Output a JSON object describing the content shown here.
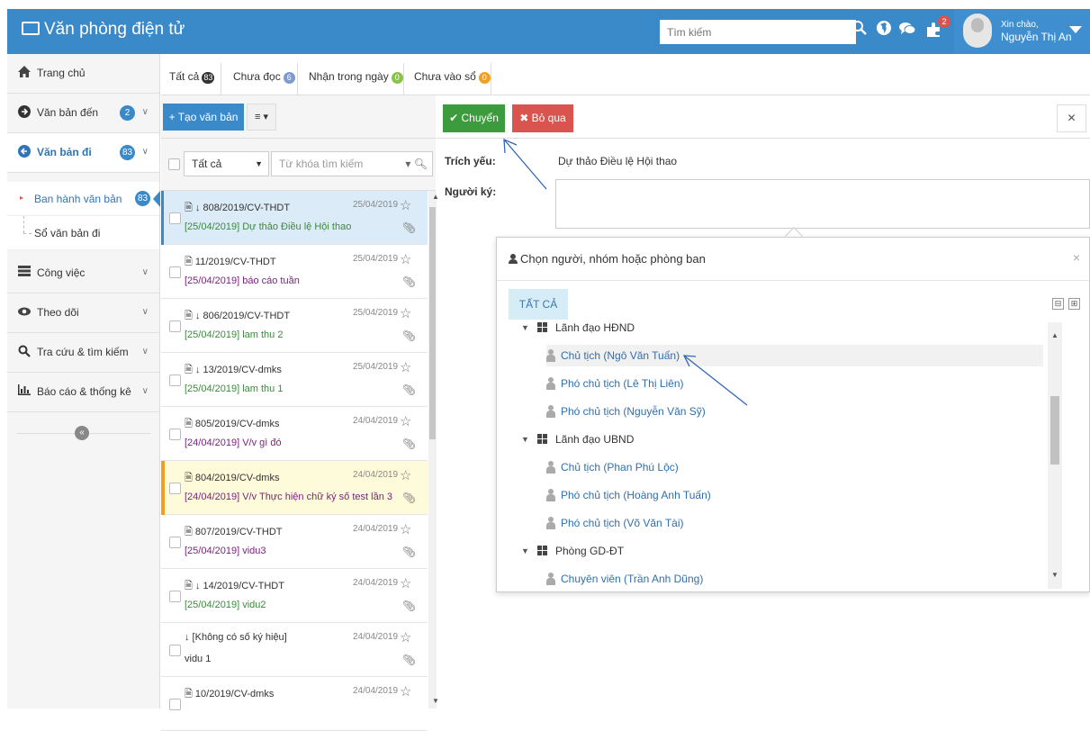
{
  "topbar": {
    "title": "Văn phòng điện tử",
    "search_placeholder": "Tìm kiếm",
    "notify_count": "2",
    "greeting": "Xin chào,",
    "user_name": "Nguyễn Thị An",
    "color": "#3a89c9"
  },
  "sidebar": {
    "home": "Trang chủ",
    "incoming": "Văn bản đến",
    "incoming_count": "2",
    "outgoing": "Văn bản đi",
    "outgoing_count": "83",
    "issue": "Ban hành văn bản",
    "issue_count": "83",
    "register": "Sổ văn bản đi",
    "work": "Công việc",
    "follow": "Theo dõi",
    "search": "Tra cứu & tìm kiếm",
    "reports": "Báo cáo & thống kê"
  },
  "tabs": [
    {
      "label": "Tất cả",
      "count": "83",
      "color": "#333333"
    },
    {
      "label": "Chưa đọc",
      "count": "6",
      "color": "#7e9bd0"
    },
    {
      "label": "Nhận trong ngày",
      "count": "0",
      "color": "#8bc34a"
    },
    {
      "label": "Chưa vào sổ",
      "count": "0",
      "color": "#f0a020"
    }
  ],
  "toolbar": {
    "create": "+ Tạo văn bản",
    "menu": "≡ ▾",
    "send": "✔ Chuyển",
    "skip": "✖ Bỏ qua"
  },
  "filter": {
    "select_value": "Tất cả",
    "keyword_placeholder": "Từ khóa tìm kiếm"
  },
  "documents": [
    {
      "number": "🗎 ↓ 808/2019/CV-THDT",
      "date": "25/04/2019",
      "subject": "[25/04/2019] Dự thảo Điều lệ Hội thao",
      "subject_color": "#3c8a3c"
    },
    {
      "number": "🗎 11/2019/CV-THDT",
      "date": "25/04/2019",
      "subject": "[25/04/2019] báo cáo tuần",
      "subject_color": "#7a1f7a"
    },
    {
      "number": "🗎 ↓ 806/2019/CV-THDT",
      "date": "25/04/2019",
      "subject": "[25/04/2019] lam thu 2",
      "subject_color": "#3c8a3c"
    },
    {
      "number": "🗎 ↓ 13/2019/CV-dmks",
      "date": "25/04/2019",
      "subject": "[25/04/2019] lam thu 1",
      "subject_color": "#3c8a3c"
    },
    {
      "number": "🗎 805/2019/CV-dmks",
      "date": "24/04/2019",
      "subject": "[24/04/2019] V/v gì đó",
      "subject_color": "#7a1f7a"
    },
    {
      "number": "🗎 804/2019/CV-dmks",
      "date": "24/04/2019",
      "subject": "[24/04/2019] V/v Thực hiện chữ ký số test lần 3",
      "subject_color": "#7a1f7a"
    },
    {
      "number": "🗎 807/2019/CV-THDT",
      "date": "24/04/2019",
      "subject": "[25/04/2019] vidu3",
      "subject_color": "#7a1f7a"
    },
    {
      "number": "🗎 ↓ 14/2019/CV-THDT",
      "date": "24/04/2019",
      "subject": "[25/04/2019] vidu2",
      "subject_color": "#3c8a3c"
    },
    {
      "number": "↓ [Không có số ký hiệu]",
      "date": "24/04/2019",
      "subject": "vidu 1",
      "subject_color": "#333333"
    },
    {
      "number": "🗎 10/2019/CV-dmks",
      "date": "24/04/2019",
      "subject": "",
      "subject_color": "#333333"
    }
  ],
  "detail": {
    "summary_label": "Trích yếu:",
    "summary_value": "Dự thảo Điều lệ Hội thao",
    "signer_label": "Người ký:"
  },
  "picker": {
    "title": "Chọn người, nhóm hoặc phòng ban",
    "close": "×",
    "tab_all": "TẤT CẢ",
    "collapse": "⊟",
    "expand": "⊞",
    "groups": [
      {
        "name": "Lãnh đạo HĐND",
        "members": [
          "Chủ tịch (Ngô Văn Tuấn)",
          "Phó chủ tịch (Lê Thị Liên)",
          "Phó chủ tịch (Nguyễn Văn Sỹ)"
        ]
      },
      {
        "name": "Lãnh đạo UBND",
        "members": [
          "Chủ tịch (Phan Phú Lộc)",
          "Phó chủ tịch (Hoàng Anh Tuấn)",
          "Phó chủ tịch (Võ Văn Tài)"
        ]
      },
      {
        "name": "Phòng GD-ĐT",
        "members": [
          "Chuyên viên (Trần Anh Dũng)"
        ]
      }
    ]
  }
}
